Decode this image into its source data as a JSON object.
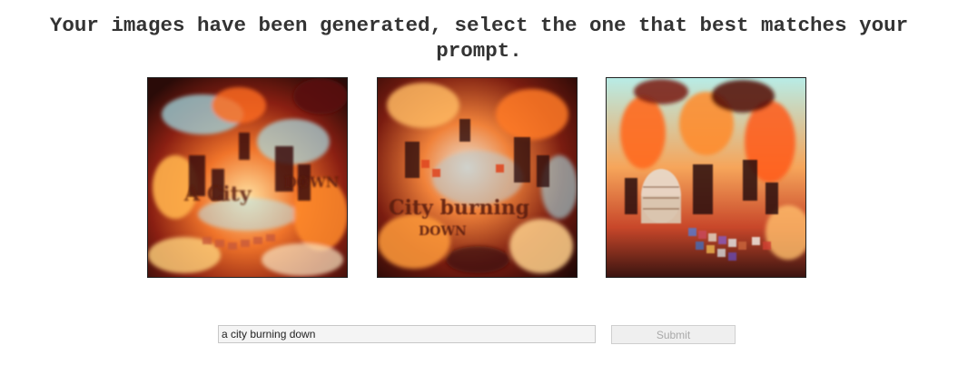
{
  "header": {
    "line1": "Your images have been generated, select the one that best matches your",
    "line2": "prompt."
  },
  "images": [
    {
      "name": "generated-image-1",
      "depicted_text": [
        "A City",
        "DOWN"
      ]
    },
    {
      "name": "generated-image-2",
      "depicted_text": [
        "City burning",
        "DOWN"
      ]
    },
    {
      "name": "generated-image-3",
      "depicted_text": []
    }
  ],
  "form": {
    "prompt_value": "a city burning down",
    "submit_label": "Submit"
  },
  "colors": {
    "fire_orange": "#e8561a",
    "fire_yellow": "#ffd27a",
    "smoke_cyan": "#9fd8e0",
    "dark_red": "#5a0f0a",
    "submit_text_disabled": "#a9a9a9"
  }
}
